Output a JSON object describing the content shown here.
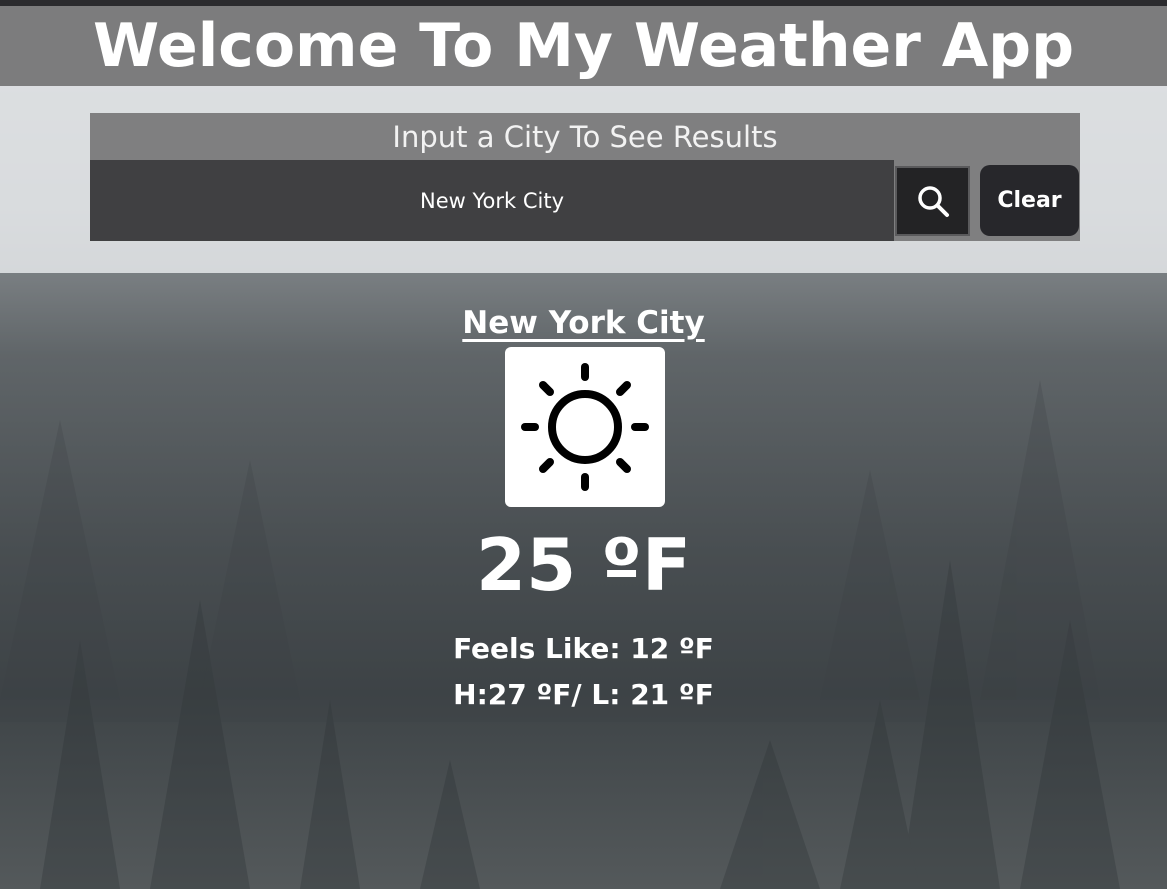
{
  "header": {
    "title": "Welcome To My Weather App"
  },
  "search": {
    "heading": "Input a City To See Results",
    "input_value": "New York City",
    "search_icon": "search-icon",
    "clear_label": "Clear"
  },
  "result": {
    "city": "New York City",
    "condition_icon": "sun-icon",
    "temperature": "25 ºF",
    "feels_like": "Feels Like: 12 ºF",
    "high_low": "H:27 ºF/ L: 21 ºF"
  },
  "colors": {
    "header_bg": "#7c7c7d",
    "input_bg": "#404042",
    "button_bg": "#27272b",
    "text": "#ffffff"
  }
}
